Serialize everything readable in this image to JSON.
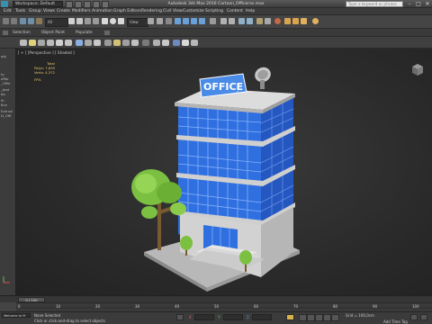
{
  "window": {
    "workspace": "Workspace: Default",
    "title": "Autodesk 3ds Max 2016     Cartoon_Officeras.max",
    "search_placeholder": "Type a keyword or phrase",
    "controls": [
      "–",
      "□",
      "✕"
    ]
  },
  "menu": [
    "Edit",
    "Tools",
    "Group",
    "Views",
    "Create",
    "Modifiers",
    "Animation",
    "Graph Editors",
    "Rendering",
    "Civil View",
    "Customize",
    "Scripting",
    "Content",
    "Help"
  ],
  "toolbar": {
    "selection_filter": "All",
    "view_dropdown": "View"
  },
  "ribbon": [
    "Selection",
    "Object Paint",
    "Populate"
  ],
  "viewport": {
    "label": "[ + ] [Perspective ] [ Shaded ]",
    "sign_text": "OFFICE",
    "stats": {
      "header": "Total",
      "polys_label": "Polys:",
      "polys": "7,835",
      "verts_label": "Verts:",
      "verts": "4,372",
      "fps_label": "FPS:"
    }
  },
  "left_panel": [
    "obj",
    "ty",
    "offer",
    "_Offic",
    "_bad",
    "ba",
    "iti",
    "fice",
    "Extrusi",
    "D_Offi"
  ],
  "timeline": {
    "frame": "0 / 100",
    "ticks": [
      "0",
      "10",
      "20",
      "30",
      "40",
      "50",
      "60",
      "70",
      "80",
      "90",
      "100"
    ]
  },
  "status": {
    "message": "Click or click-and-drag to select objects",
    "selection": "None Selected",
    "grid": "Grid = 100,0cm",
    "add_time_tag": "Add Time Tag",
    "welcome": "Welcome to M"
  },
  "colors": {
    "glass": "#2f6fe0",
    "trim": "#c9c9c9",
    "tree": "#7cc041",
    "sign_bg": "#4a8be8",
    "viewport_bg": "#2b2b2b"
  }
}
